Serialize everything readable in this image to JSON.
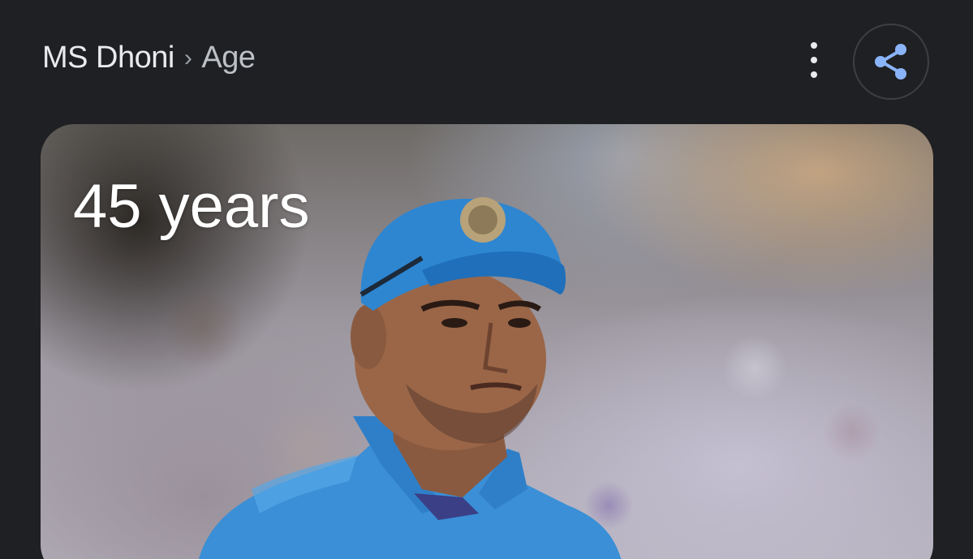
{
  "breadcrumb": {
    "entity": "MS Dhoni",
    "separator": "›",
    "attribute": "Age"
  },
  "actions": {
    "more_icon": "more-vert-icon",
    "share_icon": "share-icon",
    "accent_color": "#8ab4f8"
  },
  "card": {
    "answer": "45 years",
    "image_subject": "person-photo"
  },
  "colors": {
    "background": "#1f2023",
    "text_primary": "#e8eaed",
    "text_secondary": "#bdc1c6"
  }
}
